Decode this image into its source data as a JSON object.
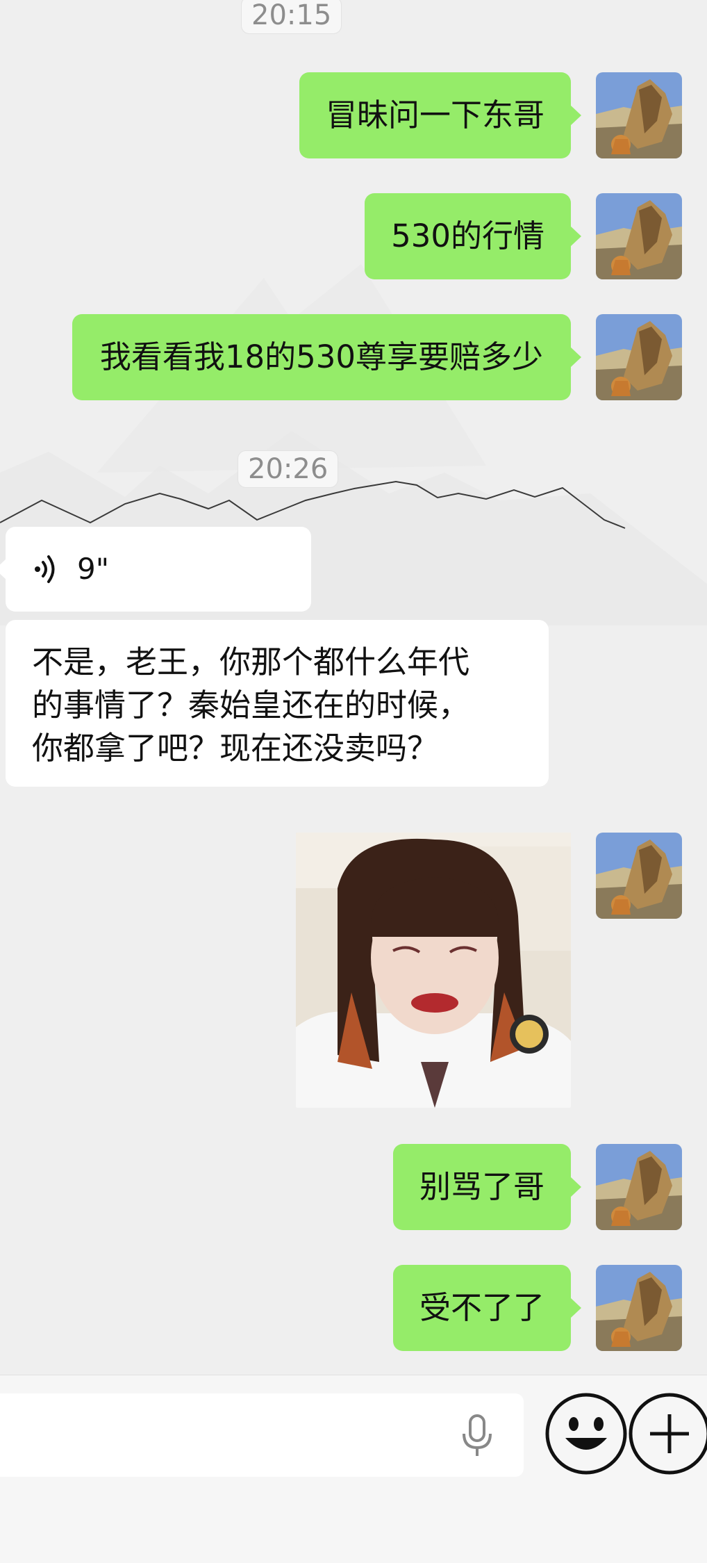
{
  "chat": {
    "timestamps": [
      "20:15",
      "20:26"
    ],
    "messages": [
      {
        "from": "me",
        "type": "text",
        "text": "冒昧问一下东哥"
      },
      {
        "from": "me",
        "type": "text",
        "text": "530的行情"
      },
      {
        "from": "me",
        "type": "text",
        "text": "我看看我18的530尊享要赔多少"
      },
      {
        "from": "other",
        "type": "voice",
        "duration": "9\""
      },
      {
        "from": "other",
        "type": "text",
        "lines": [
          "不是，老王，你那个都什么年代",
          "的事情了？秦始皇还在的时候，",
          "你都拿了吧？现在还没卖吗？"
        ]
      },
      {
        "from": "me",
        "type": "sticker",
        "description": "meme-photo"
      },
      {
        "from": "me",
        "type": "text",
        "text": "别骂了哥"
      },
      {
        "from": "me",
        "type": "text",
        "text": "受不了了"
      }
    ]
  },
  "input_bar": {
    "value": "",
    "icons": [
      "microphone-icon",
      "emoji-icon",
      "plus-icon"
    ]
  },
  "colors": {
    "my_bubble": "#95ec69",
    "other_bubble": "#ffffff",
    "background": "#efefef"
  }
}
